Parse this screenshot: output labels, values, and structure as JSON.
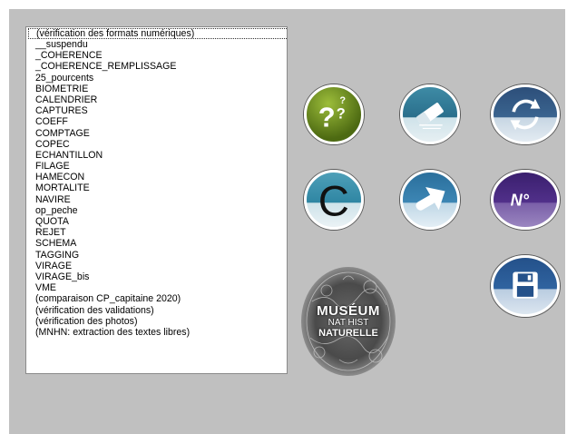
{
  "window": {
    "background_color": "#c0c0c0"
  },
  "list": {
    "items": [
      "(vérification des formats numériques)",
      "__suspendu",
      "_COHERENCE",
      "_COHERENCE_REMPLISSAGE",
      "25_pourcents",
      "BIOMETRIE",
      "CALENDRIER",
      "CAPTURES",
      "COEFF",
      "COMPTAGE",
      "COPEC",
      "ECHANTILLON",
      "FILAGE",
      "HAMECON",
      "MORTALITE",
      "NAVIRE",
      "op_peche",
      "QUOTA",
      "REJET",
      "SCHEMA",
      "TAGGING",
      "VIRAGE",
      "VIRAGE_bis",
      "VME",
      "(comparaison CP_capitaine 2020)",
      "(vérification des validations)",
      "(vérification des photos)",
      "(MNHN: extraction des textes libres)"
    ],
    "selected_index": 0
  },
  "buttons": {
    "help": {
      "icon": "question-marks-icon",
      "glyph_large": "?",
      "glyph_small": "?"
    },
    "eraser": {
      "icon": "eraser-icon"
    },
    "refresh": {
      "icon": "refresh-arrows-icon"
    },
    "c": {
      "icon": "letter-c-icon",
      "glyph": "C"
    },
    "arrow": {
      "icon": "arrow-right-icon"
    },
    "number": {
      "icon": "number-sign-icon",
      "glyph": "N°"
    },
    "save": {
      "icon": "floppy-disk-icon"
    }
  },
  "logo": {
    "line1": "MUSÉUM",
    "line2": "NAT HIST",
    "line3": "NATURELLE"
  }
}
